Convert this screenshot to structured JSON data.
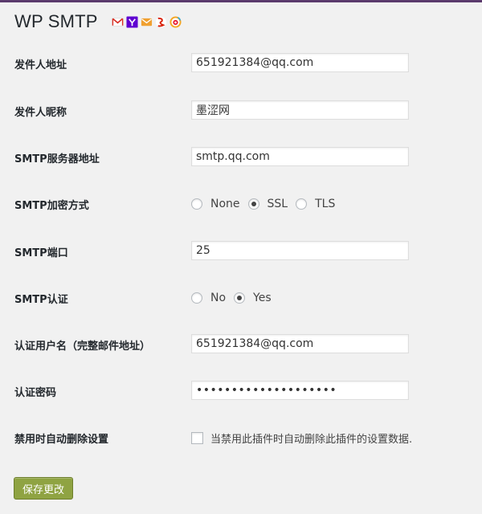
{
  "page_title": "WP SMTP",
  "provider_icons": [
    "gmail-icon",
    "yahoo-icon",
    "hotmail-icon",
    "netease-163-icon",
    "sina-icon"
  ],
  "fields": {
    "from_address": {
      "label": "发件人地址",
      "value": "651921384@qq.com"
    },
    "from_name": {
      "label": "发件人昵称",
      "value": "墨涩网"
    },
    "smtp_host": {
      "label": "SMTP服务器地址",
      "value": "smtp.qq.com"
    },
    "encryption": {
      "label": "SMTP加密方式",
      "options": [
        "None",
        "SSL",
        "TLS"
      ],
      "selected": "SSL"
    },
    "smtp_port": {
      "label": "SMTP端口",
      "value": "25"
    },
    "smtp_auth": {
      "label": "SMTP认证",
      "options": [
        "No",
        "Yes"
      ],
      "selected": "Yes"
    },
    "username": {
      "label": "认证用户名（完整邮件地址）",
      "value": "651921384@qq.com"
    },
    "password": {
      "label": "认证密码",
      "value": "••••••••••••••••••••"
    },
    "delete_on_disable": {
      "label": "禁用时自动删除设置",
      "checkbox_text": "当禁用此插件时自动删除此插件的设置数据.",
      "checked": false
    }
  },
  "save_button": "保存更改",
  "colors": {
    "top_border": "#5b3a6d",
    "button": "#8fa342",
    "background": "#f1f1f1"
  }
}
